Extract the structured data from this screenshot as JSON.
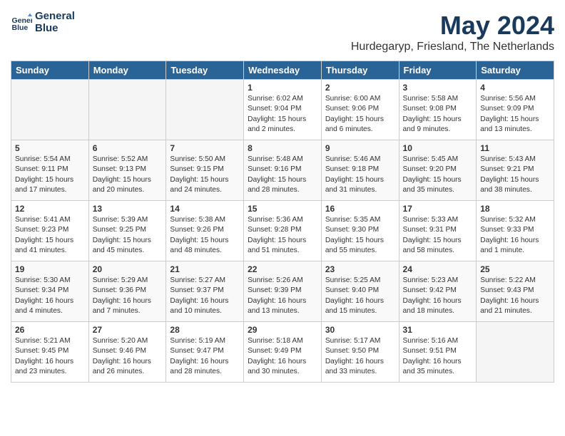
{
  "header": {
    "logo_line1": "General",
    "logo_line2": "Blue",
    "month_year": "May 2024",
    "location": "Hurdegaryp, Friesland, The Netherlands"
  },
  "days_of_week": [
    "Sunday",
    "Monday",
    "Tuesday",
    "Wednesday",
    "Thursday",
    "Friday",
    "Saturday"
  ],
  "weeks": [
    [
      {
        "day": "",
        "info": "",
        "empty": true
      },
      {
        "day": "",
        "info": "",
        "empty": true
      },
      {
        "day": "",
        "info": "",
        "empty": true
      },
      {
        "day": "1",
        "info": "Sunrise: 6:02 AM\nSunset: 9:04 PM\nDaylight: 15 hours\nand 2 minutes."
      },
      {
        "day": "2",
        "info": "Sunrise: 6:00 AM\nSunset: 9:06 PM\nDaylight: 15 hours\nand 6 minutes."
      },
      {
        "day": "3",
        "info": "Sunrise: 5:58 AM\nSunset: 9:08 PM\nDaylight: 15 hours\nand 9 minutes."
      },
      {
        "day": "4",
        "info": "Sunrise: 5:56 AM\nSunset: 9:09 PM\nDaylight: 15 hours\nand 13 minutes."
      }
    ],
    [
      {
        "day": "5",
        "info": "Sunrise: 5:54 AM\nSunset: 9:11 PM\nDaylight: 15 hours\nand 17 minutes."
      },
      {
        "day": "6",
        "info": "Sunrise: 5:52 AM\nSunset: 9:13 PM\nDaylight: 15 hours\nand 20 minutes."
      },
      {
        "day": "7",
        "info": "Sunrise: 5:50 AM\nSunset: 9:15 PM\nDaylight: 15 hours\nand 24 minutes."
      },
      {
        "day": "8",
        "info": "Sunrise: 5:48 AM\nSunset: 9:16 PM\nDaylight: 15 hours\nand 28 minutes."
      },
      {
        "day": "9",
        "info": "Sunrise: 5:46 AM\nSunset: 9:18 PM\nDaylight: 15 hours\nand 31 minutes."
      },
      {
        "day": "10",
        "info": "Sunrise: 5:45 AM\nSunset: 9:20 PM\nDaylight: 15 hours\nand 35 minutes."
      },
      {
        "day": "11",
        "info": "Sunrise: 5:43 AM\nSunset: 9:21 PM\nDaylight: 15 hours\nand 38 minutes."
      }
    ],
    [
      {
        "day": "12",
        "info": "Sunrise: 5:41 AM\nSunset: 9:23 PM\nDaylight: 15 hours\nand 41 minutes."
      },
      {
        "day": "13",
        "info": "Sunrise: 5:39 AM\nSunset: 9:25 PM\nDaylight: 15 hours\nand 45 minutes."
      },
      {
        "day": "14",
        "info": "Sunrise: 5:38 AM\nSunset: 9:26 PM\nDaylight: 15 hours\nand 48 minutes."
      },
      {
        "day": "15",
        "info": "Sunrise: 5:36 AM\nSunset: 9:28 PM\nDaylight: 15 hours\nand 51 minutes."
      },
      {
        "day": "16",
        "info": "Sunrise: 5:35 AM\nSunset: 9:30 PM\nDaylight: 15 hours\nand 55 minutes."
      },
      {
        "day": "17",
        "info": "Sunrise: 5:33 AM\nSunset: 9:31 PM\nDaylight: 15 hours\nand 58 minutes."
      },
      {
        "day": "18",
        "info": "Sunrise: 5:32 AM\nSunset: 9:33 PM\nDaylight: 16 hours\nand 1 minute."
      }
    ],
    [
      {
        "day": "19",
        "info": "Sunrise: 5:30 AM\nSunset: 9:34 PM\nDaylight: 16 hours\nand 4 minutes."
      },
      {
        "day": "20",
        "info": "Sunrise: 5:29 AM\nSunset: 9:36 PM\nDaylight: 16 hours\nand 7 minutes."
      },
      {
        "day": "21",
        "info": "Sunrise: 5:27 AM\nSunset: 9:37 PM\nDaylight: 16 hours\nand 10 minutes."
      },
      {
        "day": "22",
        "info": "Sunrise: 5:26 AM\nSunset: 9:39 PM\nDaylight: 16 hours\nand 13 minutes."
      },
      {
        "day": "23",
        "info": "Sunrise: 5:25 AM\nSunset: 9:40 PM\nDaylight: 16 hours\nand 15 minutes."
      },
      {
        "day": "24",
        "info": "Sunrise: 5:23 AM\nSunset: 9:42 PM\nDaylight: 16 hours\nand 18 minutes."
      },
      {
        "day": "25",
        "info": "Sunrise: 5:22 AM\nSunset: 9:43 PM\nDaylight: 16 hours\nand 21 minutes."
      }
    ],
    [
      {
        "day": "26",
        "info": "Sunrise: 5:21 AM\nSunset: 9:45 PM\nDaylight: 16 hours\nand 23 minutes."
      },
      {
        "day": "27",
        "info": "Sunrise: 5:20 AM\nSunset: 9:46 PM\nDaylight: 16 hours\nand 26 minutes."
      },
      {
        "day": "28",
        "info": "Sunrise: 5:19 AM\nSunset: 9:47 PM\nDaylight: 16 hours\nand 28 minutes."
      },
      {
        "day": "29",
        "info": "Sunrise: 5:18 AM\nSunset: 9:49 PM\nDaylight: 16 hours\nand 30 minutes."
      },
      {
        "day": "30",
        "info": "Sunrise: 5:17 AM\nSunset: 9:50 PM\nDaylight: 16 hours\nand 33 minutes."
      },
      {
        "day": "31",
        "info": "Sunrise: 5:16 AM\nSunset: 9:51 PM\nDaylight: 16 hours\nand 35 minutes."
      },
      {
        "day": "",
        "info": "",
        "empty": true
      }
    ]
  ]
}
